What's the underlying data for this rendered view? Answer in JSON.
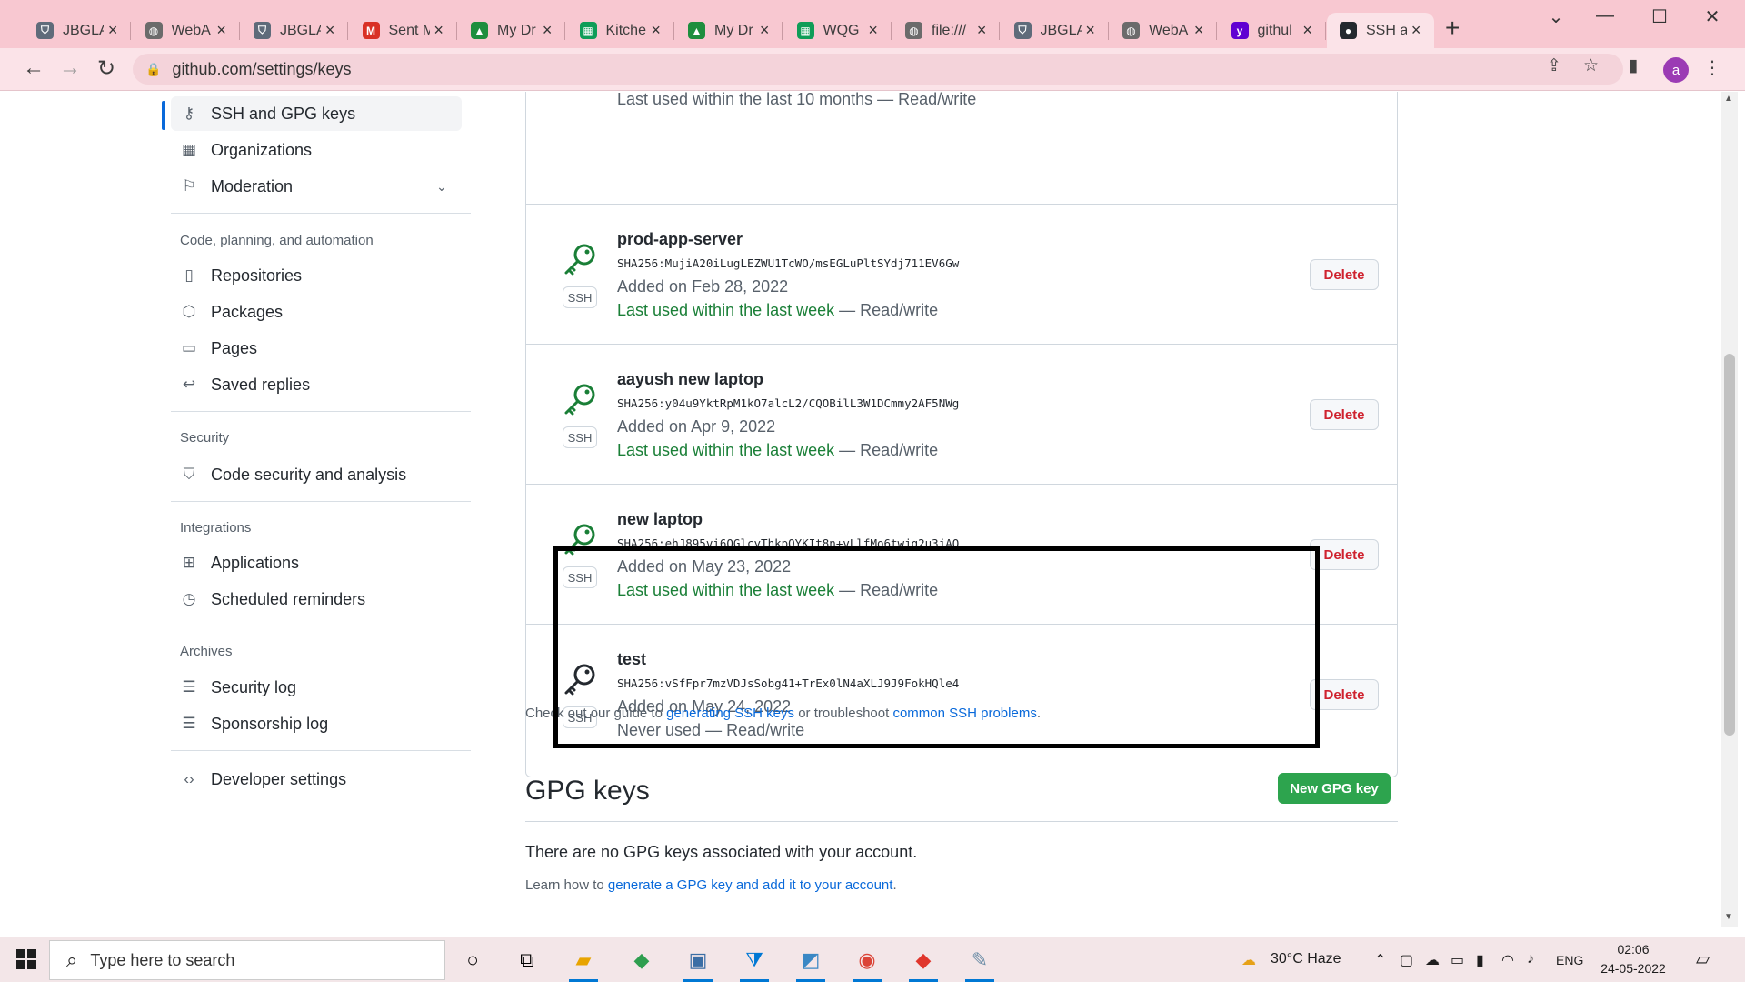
{
  "browser": {
    "tabs": [
      {
        "label": "JBGLA",
        "icon": "shield-icon"
      },
      {
        "label": "WebA",
        "icon": "globe-icon"
      },
      {
        "label": "JBGLA",
        "icon": "shield-icon"
      },
      {
        "label": "Sent M",
        "icon": "gmail-icon"
      },
      {
        "label": "My Dr",
        "icon": "drive-icon"
      },
      {
        "label": "Kitche",
        "icon": "sheets-icon"
      },
      {
        "label": "My Dr",
        "icon": "drive-icon"
      },
      {
        "label": "WQG",
        "icon": "sheets-icon"
      },
      {
        "label": "file:///",
        "icon": "globe-icon"
      },
      {
        "label": "JBGLA",
        "icon": "shield-icon"
      },
      {
        "label": "WebA",
        "icon": "globe-icon"
      },
      {
        "label": "githul",
        "icon": "yahoo-icon"
      },
      {
        "label": "SSH a",
        "icon": "github-icon",
        "active": true
      }
    ],
    "url": "github.com/settings/keys",
    "avatar_letter": "a"
  },
  "sidebar": {
    "items_top": [
      {
        "label": "SSH and GPG keys",
        "icon": "key-icon",
        "selected": true
      },
      {
        "label": "Organizations",
        "icon": "organization-icon"
      },
      {
        "label": "Moderation",
        "icon": "report-icon"
      }
    ],
    "section_code": {
      "heading": "Code, planning, and automation",
      "items": [
        {
          "label": "Repositories",
          "icon": "repo-icon"
        },
        {
          "label": "Packages",
          "icon": "package-icon"
        },
        {
          "label": "Pages",
          "icon": "browser-icon"
        },
        {
          "label": "Saved replies",
          "icon": "reply-icon"
        }
      ]
    },
    "section_security": {
      "heading": "Security",
      "items": [
        {
          "label": "Code security and analysis",
          "icon": "shield-icon"
        }
      ]
    },
    "section_integrations": {
      "heading": "Integrations",
      "items": [
        {
          "label": "Applications",
          "icon": "apps-icon"
        },
        {
          "label": "Scheduled reminders",
          "icon": "clock-icon"
        }
      ]
    },
    "section_archives": {
      "heading": "Archives",
      "items": [
        {
          "label": "Security log",
          "icon": "log-icon"
        },
        {
          "label": "Sponsorship log",
          "icon": "log-icon"
        }
      ]
    },
    "developer": {
      "label": "Developer settings",
      "icon": "code-icon"
    }
  },
  "ssh_keys": {
    "partial_last_used": "Last used within the last 10 months — Read/write",
    "badge": "SSH",
    "delete_label": "Delete",
    "keys": [
      {
        "name": "prod-app-server",
        "fingerprint": "SHA256:MujiA20iLugLEZWU1TcWO/msEGLuPltSYdj711EV6Gw",
        "added": "Added on Feb 28, 2022",
        "used": "Last used within the last week",
        "access": " — Read/write",
        "recent": true
      },
      {
        "name": "aayush new laptop",
        "fingerprint": "SHA256:y04u9YktRpM1kO7alcL2/CQOBilL3W1DCmmy2AF5NWg",
        "added": "Added on Apr 9, 2022",
        "used": "Last used within the last week",
        "access": " — Read/write",
        "recent": true
      },
      {
        "name": "new laptop",
        "fingerprint": "SHA256:ehJ895vi6QGlcyThkpOYKIt8n+vLlfMo6twjg2u3jAQ",
        "added": "Added on May 23, 2022",
        "used": "Last used within the last week",
        "access": " — Read/write",
        "recent": true
      },
      {
        "name": "test",
        "fingerprint": "SHA256:vSfFpr7mzVDJsSobg41+TrEx0lN4aXLJ9J9FokHQle4",
        "added": "Added on May 24, 2022",
        "used": "Never used",
        "access": " — Read/write",
        "recent": false
      }
    ],
    "guide_prefix": "Check out our guide to ",
    "guide_link1": "generating SSH keys",
    "guide_middle": " or troubleshoot ",
    "guide_link2": "common SSH problems",
    "guide_suffix": "."
  },
  "gpg": {
    "title": "GPG keys",
    "new_button": "New GPG key",
    "empty": "There are no GPG keys associated with your account.",
    "learn_prefix": "Learn how to ",
    "learn_link": "generate a GPG key and add it to your account",
    "learn_suffix": "."
  },
  "taskbar": {
    "search_placeholder": "Type here to search",
    "weather": "30°C  Haze",
    "lang": "ENG",
    "time": "02:06",
    "date": "24-05-2022"
  }
}
